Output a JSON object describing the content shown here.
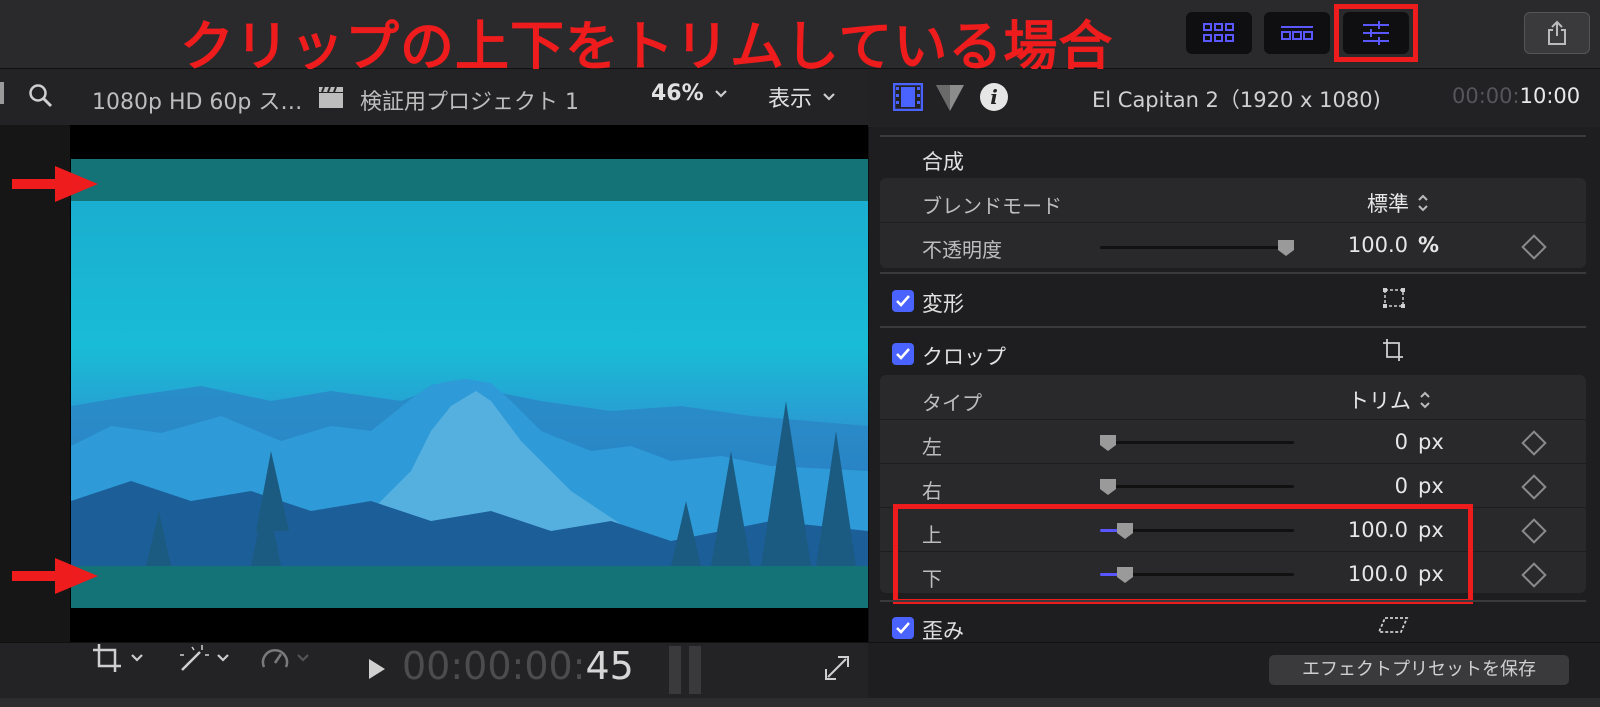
{
  "annotation": {
    "headline": "クリップの上下をトリムしている場合"
  },
  "viewer": {
    "format": "1080p HD 60p ス…",
    "project": "検証用プロジェクト 1",
    "zoom": "46%",
    "display_menu": "表示",
    "timecode_dim": "00:00:00:",
    "timecode_bright": "45"
  },
  "inspector": {
    "clip_name": "El Capitan 2（1920 x 1080)",
    "duration_dim": "00:00:",
    "duration_bright": "10:00",
    "compositing": {
      "title": "合成",
      "blend_mode_label": "ブレンドモード",
      "blend_mode_value": "標準",
      "opacity_label": "不透明度",
      "opacity_value": "100.0",
      "opacity_unit": "%"
    },
    "transform": {
      "title": "変形",
      "enabled": true
    },
    "crop": {
      "title": "クロップ",
      "enabled": true,
      "type_label": "タイプ",
      "type_value": "トリム",
      "left_label": "左",
      "left_value": "0",
      "left_unit": "px",
      "right_label": "右",
      "right_value": "0",
      "right_unit": "px",
      "top_label": "上",
      "top_value": "100.0",
      "top_unit": "px",
      "bottom_label": "下",
      "bottom_value": "100.0",
      "bottom_unit": "px"
    },
    "distort": {
      "title": "歪み",
      "enabled": true
    },
    "save_preset": "エフェクトプリセットを保存"
  },
  "colors": {
    "annotation_red": "#ee1c1c",
    "accent_blue": "#4a63ff"
  }
}
